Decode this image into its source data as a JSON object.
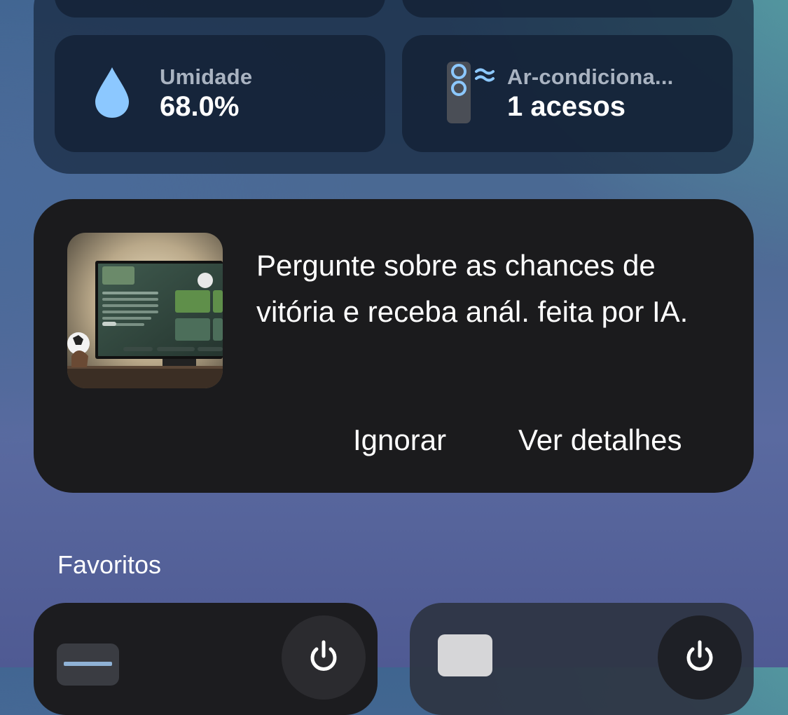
{
  "sensors": {
    "humidity": {
      "icon": "water-drop-icon",
      "label": "Umidade",
      "value": "68.0%",
      "icon_color": "#8cc8ff"
    },
    "air_conditioning": {
      "icon": "ac-remote-icon",
      "label": "Ar-condiciona...",
      "value": "1 acesos",
      "icon_color": "#8cc8ff"
    }
  },
  "suggestion": {
    "text": "Pergunte sobre as chances de vitória e receba anál. feita por IA.",
    "image": "tv-soccer-analysis-thumbnail",
    "ignore_label": "Ignorar",
    "details_label": "Ver detalhes"
  },
  "favorites": {
    "title": "Favoritos",
    "items": [
      {
        "icon": "device-panel-icon",
        "power_icon": "power-icon"
      },
      {
        "icon": "device-box-icon",
        "power_icon": "power-icon"
      }
    ]
  },
  "colors": {
    "card_background": "#1b1b1d",
    "accent_blue": "#8cc8ff",
    "text_primary": "#ffffff",
    "text_secondary": "#a9b3c1"
  }
}
